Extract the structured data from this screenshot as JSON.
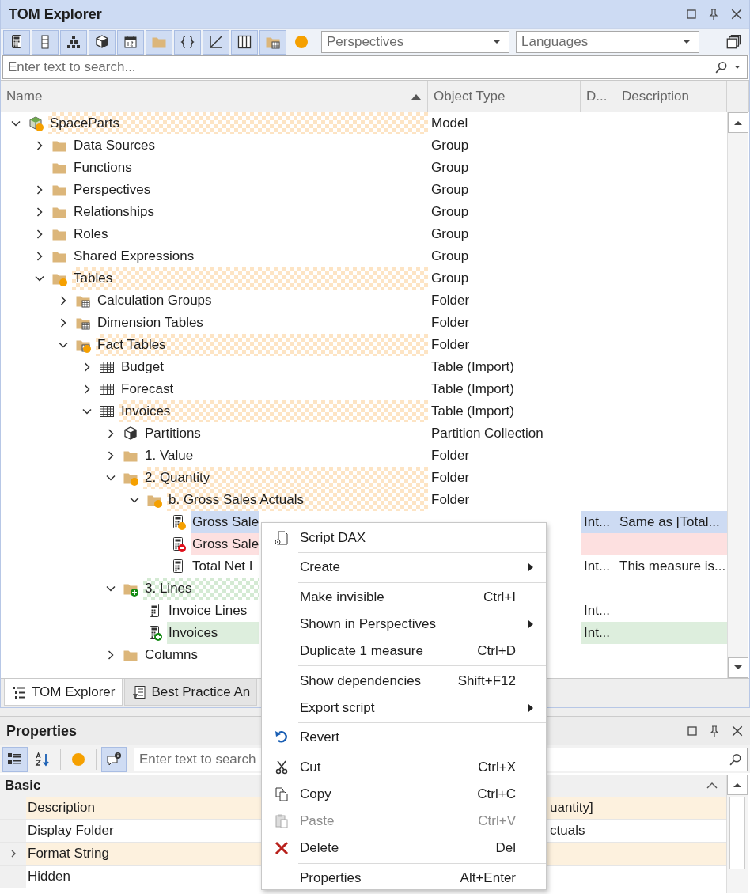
{
  "window": {
    "title": "TOM Explorer"
  },
  "toolbar": {
    "buttons": [
      {
        "kind": "calculator",
        "pressed": true
      },
      {
        "kind": "column",
        "pressed": true
      },
      {
        "kind": "hierarchy",
        "pressed": true
      },
      {
        "kind": "cube",
        "pressed": true
      },
      {
        "kind": "calendar",
        "pressed": true
      },
      {
        "kind": "folder",
        "pressed": true
      },
      {
        "kind": "braces",
        "pressed": true
      },
      {
        "kind": "diagonal",
        "pressed": true
      },
      {
        "kind": "columns",
        "pressed": true
      },
      {
        "kind": "folder-table",
        "pressed": true
      },
      {
        "kind": "dot",
        "pressed": false
      }
    ],
    "perspectives": {
      "placeholder": "Perspectives"
    },
    "languages": {
      "placeholder": "Languages"
    }
  },
  "search": {
    "placeholder": "Enter text to search..."
  },
  "columns": [
    "Name",
    "Object Type",
    "D...",
    "Description"
  ],
  "tree": [
    {
      "label": "SpaceParts",
      "kind": "model",
      "modified": true,
      "added": false,
      "deleted": false,
      "contains_changes": true,
      "selected": false,
      "expanded": true,
      "type": "Model",
      "children": [
        {
          "label": "Data Sources",
          "kind": "folder",
          "modified": false,
          "added": false,
          "deleted": false,
          "contains_changes": false,
          "selected": false,
          "expanded": false,
          "type": "Group"
        },
        {
          "label": "Functions",
          "kind": "folder",
          "modified": false,
          "added": false,
          "deleted": false,
          "contains_changes": false,
          "selected": false,
          "type": "Group"
        },
        {
          "label": "Perspectives",
          "kind": "folder",
          "modified": false,
          "added": false,
          "deleted": false,
          "contains_changes": false,
          "selected": false,
          "expanded": false,
          "type": "Group"
        },
        {
          "label": "Relationships",
          "kind": "folder",
          "modified": false,
          "added": false,
          "deleted": false,
          "contains_changes": false,
          "selected": false,
          "expanded": false,
          "type": "Group"
        },
        {
          "label": "Roles",
          "kind": "folder",
          "modified": false,
          "added": false,
          "deleted": false,
          "contains_changes": false,
          "selected": false,
          "expanded": false,
          "type": "Group"
        },
        {
          "label": "Shared Expressions",
          "kind": "folder",
          "modified": false,
          "added": false,
          "deleted": false,
          "contains_changes": false,
          "selected": false,
          "expanded": false,
          "type": "Group"
        },
        {
          "label": "Tables",
          "kind": "folder",
          "modified": true,
          "added": false,
          "deleted": false,
          "contains_changes": true,
          "selected": false,
          "expanded": true,
          "type": "Group",
          "children": [
            {
              "label": "Calculation Groups",
              "kind": "folder-table",
              "modified": false,
              "added": false,
              "deleted": false,
              "contains_changes": false,
              "selected": false,
              "expanded": false,
              "type": "Folder"
            },
            {
              "label": "Dimension Tables",
              "kind": "folder-table",
              "modified": false,
              "added": false,
              "deleted": false,
              "contains_changes": false,
              "selected": false,
              "expanded": false,
              "type": "Folder"
            },
            {
              "label": "Fact Tables",
              "kind": "folder-table",
              "modified": true,
              "added": false,
              "deleted": false,
              "contains_changes": true,
              "selected": false,
              "expanded": true,
              "type": "Folder",
              "children": [
                {
                  "label": "Budget",
                  "kind": "table",
                  "modified": false,
                  "added": false,
                  "deleted": false,
                  "contains_changes": false,
                  "selected": false,
                  "expanded": false,
                  "type": "Table (Import)"
                },
                {
                  "label": "Forecast",
                  "kind": "table",
                  "modified": false,
                  "added": false,
                  "deleted": false,
                  "contains_changes": false,
                  "selected": false,
                  "expanded": false,
                  "type": "Table (Import)"
                },
                {
                  "label": "Invoices",
                  "kind": "table",
                  "modified": false,
                  "added": false,
                  "deleted": false,
                  "contains_changes": true,
                  "selected": false,
                  "expanded": true,
                  "type": "Table (Import)",
                  "children": [
                    {
                      "label": "Partitions",
                      "kind": "cube",
                      "modified": false,
                      "added": false,
                      "deleted": false,
                      "contains_changes": false,
                      "selected": false,
                      "expanded": false,
                      "type": "Partition Collection"
                    },
                    {
                      "label": "1. Value",
                      "kind": "folder",
                      "modified": false,
                      "added": false,
                      "deleted": false,
                      "contains_changes": false,
                      "selected": false,
                      "expanded": false,
                      "type": "Folder"
                    },
                    {
                      "label": "2. Quantity",
                      "kind": "folder",
                      "modified": true,
                      "added": false,
                      "deleted": false,
                      "contains_changes": true,
                      "selected": false,
                      "expanded": true,
                      "type": "Folder",
                      "children": [
                        {
                          "label": "b. Gross Sales Actuals",
                          "kind": "folder",
                          "modified": true,
                          "added": false,
                          "deleted": false,
                          "contains_changes": true,
                          "selected": false,
                          "expanded": true,
                          "type": "Folder",
                          "children": [
                            {
                              "label": "Gross Sale",
                              "kind": "measure",
                              "modified": true,
                              "added": false,
                              "deleted": false,
                              "contains_changes": false,
                              "selected": true,
                              "d": "Int...",
                              "description": "Same as [Total..."
                            },
                            {
                              "label": "Gross Sale",
                              "kind": "measure",
                              "modified": false,
                              "added": false,
                              "deleted": true,
                              "contains_changes": false,
                              "selected": false
                            },
                            {
                              "label": "Total Net I",
                              "kind": "measure",
                              "modified": false,
                              "added": false,
                              "deleted": false,
                              "contains_changes": false,
                              "selected": false,
                              "d": "Int...",
                              "description": "This measure is..."
                            }
                          ]
                        }
                      ]
                    },
                    {
                      "label": "3. Lines",
                      "kind": "folder",
                      "modified": false,
                      "added": true,
                      "deleted": false,
                      "contains_changes": true,
                      "selected": false,
                      "expanded": true,
                      "children": [
                        {
                          "label": "Invoice Lines",
                          "kind": "measure",
                          "modified": false,
                          "added": false,
                          "deleted": false,
                          "contains_changes": false,
                          "selected": false,
                          "d": "Int..."
                        },
                        {
                          "label": "Invoices",
                          "kind": "measure",
                          "modified": false,
                          "added": true,
                          "deleted": false,
                          "contains_changes": false,
                          "selected": false,
                          "d": "Int..."
                        }
                      ]
                    },
                    {
                      "label": "Columns",
                      "kind": "folder",
                      "modified": false,
                      "added": false,
                      "deleted": false,
                      "contains_changes": false,
                      "selected": false,
                      "expanded": false
                    }
                  ]
                }
              ]
            }
          ]
        }
      ]
    }
  ],
  "tabs": [
    {
      "label": "TOM Explorer",
      "kind": "tree",
      "selected": true
    },
    {
      "label": "Best Practice An",
      "kind": "checklist",
      "selected": false
    }
  ],
  "properties": {
    "title": "Properties",
    "toolbar": [
      {
        "kind": "categorized",
        "pressed": true
      },
      {
        "kind": "alphabetical",
        "pressed": false
      },
      {
        "kind": "dot",
        "pressed": false
      },
      {
        "kind": "comment",
        "pressed": true
      }
    ],
    "search": {
      "placeholder": "Enter text to search"
    },
    "category": {
      "label": "Basic",
      "expanded": true
    },
    "rows": [
      {
        "name": "Description",
        "value": "uantity]",
        "modified": true
      },
      {
        "name": "Display Folder",
        "value": "ctuals",
        "modified": false
      },
      {
        "name": "Format String",
        "modified": true,
        "expanded": false
      },
      {
        "name": "Hidden",
        "modified": false
      }
    ]
  },
  "context_menu": {
    "groups": [
      [
        {
          "label": "Script DAX",
          "kind": "script",
          "submenu": false,
          "disabled": false
        }
      ],
      [
        {
          "label": "Create",
          "kind": "plain",
          "submenu": true,
          "disabled": false
        }
      ],
      [
        {
          "label": "Make invisible",
          "kind": "plain",
          "shortcut": "Ctrl+I",
          "submenu": false,
          "disabled": false
        },
        {
          "label": "Shown in Perspectives",
          "kind": "plain",
          "submenu": true,
          "disabled": false
        },
        {
          "label": "Duplicate 1 measure",
          "kind": "plain",
          "shortcut": "Ctrl+D",
          "submenu": false,
          "disabled": false
        }
      ],
      [
        {
          "label": "Show dependencies",
          "kind": "plain",
          "shortcut": "Shift+F12",
          "submenu": false,
          "disabled": false
        },
        {
          "label": "Export script",
          "kind": "plain",
          "submenu": true,
          "disabled": false
        }
      ],
      [
        {
          "label": "Revert",
          "kind": "revert",
          "submenu": false,
          "disabled": false
        }
      ],
      [
        {
          "label": "Cut",
          "kind": "cut",
          "shortcut": "Ctrl+X",
          "submenu": false,
          "disabled": false
        },
        {
          "label": "Copy",
          "kind": "copy",
          "shortcut": "Ctrl+C",
          "submenu": false,
          "disabled": false
        },
        {
          "label": "Paste",
          "kind": "paste",
          "shortcut": "Ctrl+V",
          "submenu": false,
          "disabled": true
        },
        {
          "label": "Delete",
          "kind": "delete",
          "shortcut": "Del",
          "submenu": false,
          "disabled": false
        }
      ],
      [
        {
          "label": "Properties",
          "kind": "plain",
          "shortcut": "Alt+Enter",
          "submenu": false,
          "disabled": false
        }
      ]
    ]
  }
}
